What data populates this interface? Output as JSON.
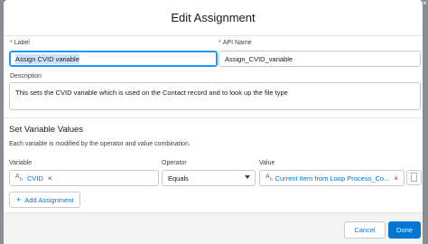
{
  "dialog": {
    "title": "Edit Assignment",
    "close_glyph": "×"
  },
  "form": {
    "label": {
      "title": "Label",
      "required_mark": "*",
      "value": "Assign CVID variable"
    },
    "api_name": {
      "title": "API Name",
      "required_mark": "*",
      "value": "Assign_CVID_variable"
    },
    "description": {
      "title": "Description",
      "value": "This sets the CVID variable which is used on the Contact record and to look up the file type"
    }
  },
  "variables_section": {
    "title": "Set Variable Values",
    "help": "Each variable is modified by the operator and value combination.",
    "columns": {
      "variable": "Variable",
      "operator": "Operator",
      "value": "Value"
    },
    "row": {
      "variable": "CVID",
      "operator": "Equals",
      "value": "Current Item from Loop Process_Co..."
    },
    "add_label": "Add Assignment",
    "add_glyph": "+",
    "remove_glyph": "×"
  },
  "footer": {
    "cancel_label": "Cancel",
    "done_label": "Done"
  },
  "icons": {
    "resource_icon": "text-resource-icon",
    "delete_icon": "trash-icon",
    "dropdown_icon": "chevron-down-icon"
  },
  "colors": {
    "brand": "#0176d3",
    "required": "#c23934",
    "focus": "#1b96ff"
  }
}
